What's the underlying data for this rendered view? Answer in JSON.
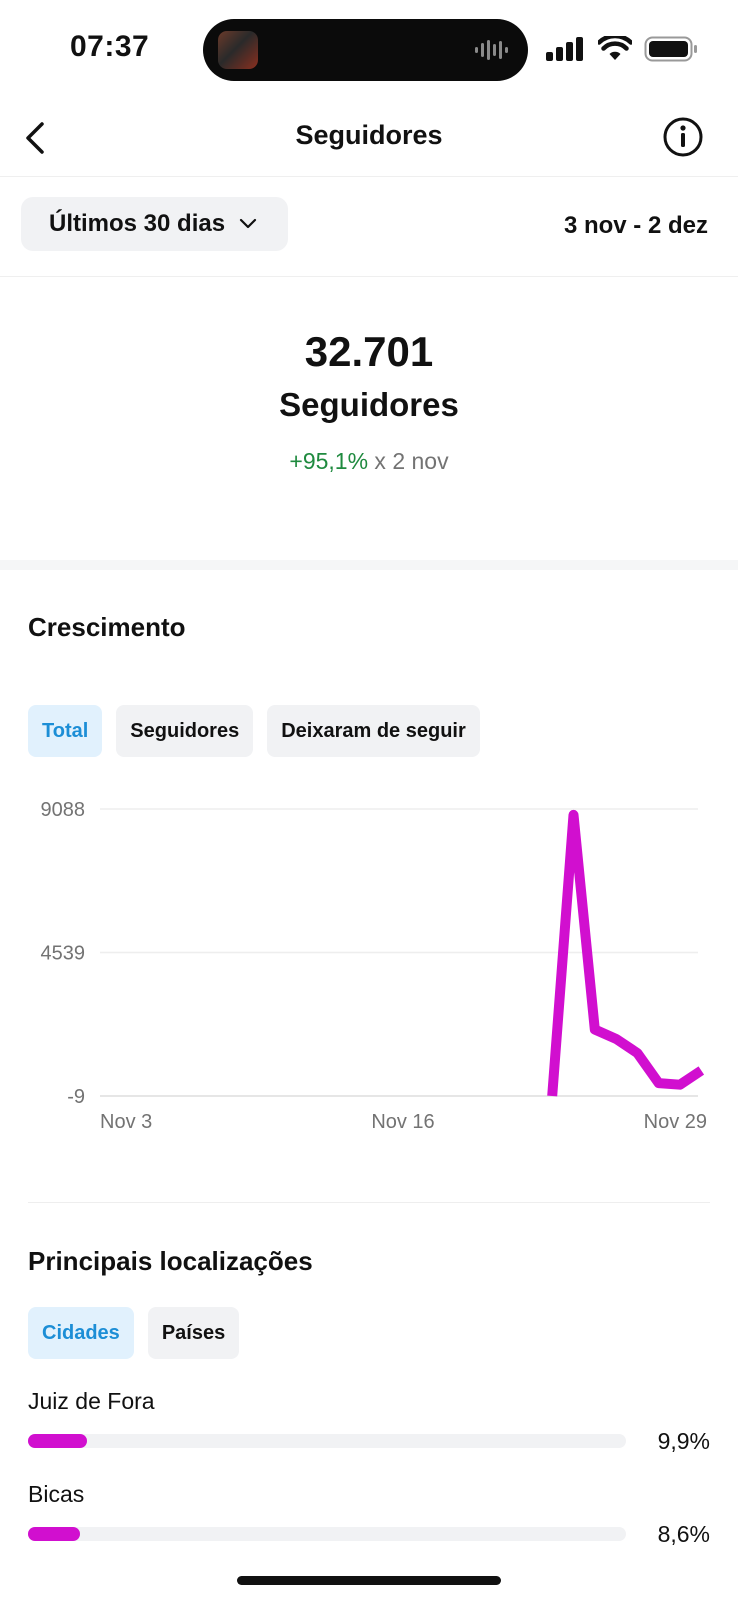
{
  "status_bar": {
    "time": "07:37"
  },
  "header": {
    "title": "Seguidores",
    "back_icon": "chevron-left-icon",
    "info_icon": "info-icon"
  },
  "range": {
    "selected": "Últimos 30 dias",
    "dates": "3 nov - 2 dez"
  },
  "summary": {
    "count": "32.701",
    "label": "Seguidores",
    "change_value": "+95,1%",
    "change_suffix": " x 2 nov"
  },
  "growth": {
    "title": "Crescimento",
    "tabs": [
      {
        "label": "Total",
        "active": true
      },
      {
        "label": "Seguidores",
        "active": false
      },
      {
        "label": "Deixaram de seguir",
        "active": false
      }
    ]
  },
  "chart_data": {
    "type": "line",
    "title": "",
    "xlabel": "",
    "ylabel": "",
    "y_ticks": [
      "9088",
      "4539",
      "-9"
    ],
    "x_ticks": [
      "Nov 3",
      "Nov 16",
      "Nov 29"
    ],
    "ylim": [
      -9,
      9088
    ],
    "grid": true,
    "color": "#d10fcf",
    "x": [
      "Nov 23",
      "Nov 24",
      "Nov 25",
      "Nov 26",
      "Nov 27",
      "Nov 28",
      "Nov 29",
      "Nov 30"
    ],
    "values": [
      -9,
      8900,
      2100,
      1800,
      1350,
      400,
      350,
      800
    ]
  },
  "locations": {
    "title": "Principais localizações",
    "tabs": [
      {
        "label": "Cidades",
        "active": true
      },
      {
        "label": "Países",
        "active": false
      }
    ],
    "items": [
      {
        "name": "Juiz de Fora",
        "percent": "9,9%",
        "fraction": 0.099
      },
      {
        "name": "Bicas",
        "percent": "8,6%",
        "fraction": 0.086
      }
    ],
    "bar_color": "#d10fcf"
  }
}
